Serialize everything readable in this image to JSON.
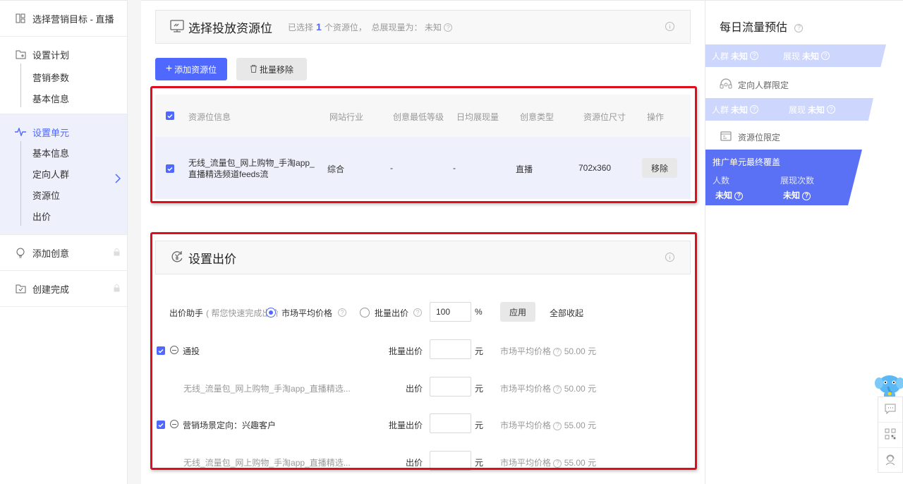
{
  "sidebar": {
    "target": "选择营销目标 - 直播",
    "plan": {
      "label": "设置计划",
      "children": [
        "营销参数",
        "基本信息"
      ]
    },
    "unit": {
      "label": "设置单元",
      "children": [
        "基本信息",
        "定向人群",
        "资源位",
        "出价"
      ]
    },
    "creative": "添加创意",
    "done": "创建完成"
  },
  "resource_panel": {
    "title": "选择投放资源位",
    "selected_prefix": "已选择",
    "selected_count": "1",
    "selected_suffix": "个资源位，",
    "exposure_label": "总展现量为：",
    "exposure_value": "未知",
    "add_button": "添加资源位",
    "remove_batch_button": "批量移除",
    "columns": [
      "资源位信息",
      "网站行业",
      "创意最低等级",
      "日均展现量",
      "创意类型",
      "资源位尺寸",
      "操作"
    ],
    "rows": [
      {
        "name_line1": "无线_流量包_网上购物_手淘app_",
        "name_line2": "直播精选频道feeds流",
        "industry": "综合",
        "min_level": "-",
        "daily_exposure": "-",
        "creative_type": "直播",
        "size": "702x360",
        "action": "移除"
      }
    ]
  },
  "bid_panel": {
    "title": "设置出价",
    "helper_label": "出价助手",
    "helper_hint": "( 帮您快速完成出价",
    "option_market": "市场平均价格",
    "option_batch": "批量出价",
    "batch_value": "100",
    "percent": "%",
    "apply_button": "应用",
    "collapse_all": "全部收起",
    "unit": "元",
    "groups": [
      {
        "name": "通投",
        "bid_label": "批量出价",
        "market_label": "市场平均价格",
        "market_price": "50.00 元"
      },
      {
        "name": "无线_流量包_网上购物_手淘app_直播精选...",
        "bid_label": "出价",
        "market_label": "市场平均价格",
        "market_price": "50.00 元"
      },
      {
        "name": "营销场景定向：兴趣客户",
        "bid_label": "批量出价",
        "market_label": "市场平均价格",
        "market_price": "55.00 元"
      },
      {
        "name": "无线_流量包_网上购物_手淘app_直播精选...",
        "bid_label": "出价",
        "market_label": "市场平均价格",
        "market_price": "55.00 元"
      }
    ]
  },
  "forecast": {
    "title": "每日流量预估",
    "crowd_label": "人群",
    "exposure_label": "展现",
    "unknown": "未知",
    "crowd_limit": "定向人群限定",
    "resource_limit": "资源位限定",
    "final_title": "推广单元最终覆盖",
    "people_label": "人数",
    "times_label": "展现次数"
  },
  "colors": {
    "accent": "#4f68ff",
    "highlight": "#e00d1f",
    "band": "#cdd6fd",
    "final": "#5b71f5"
  }
}
